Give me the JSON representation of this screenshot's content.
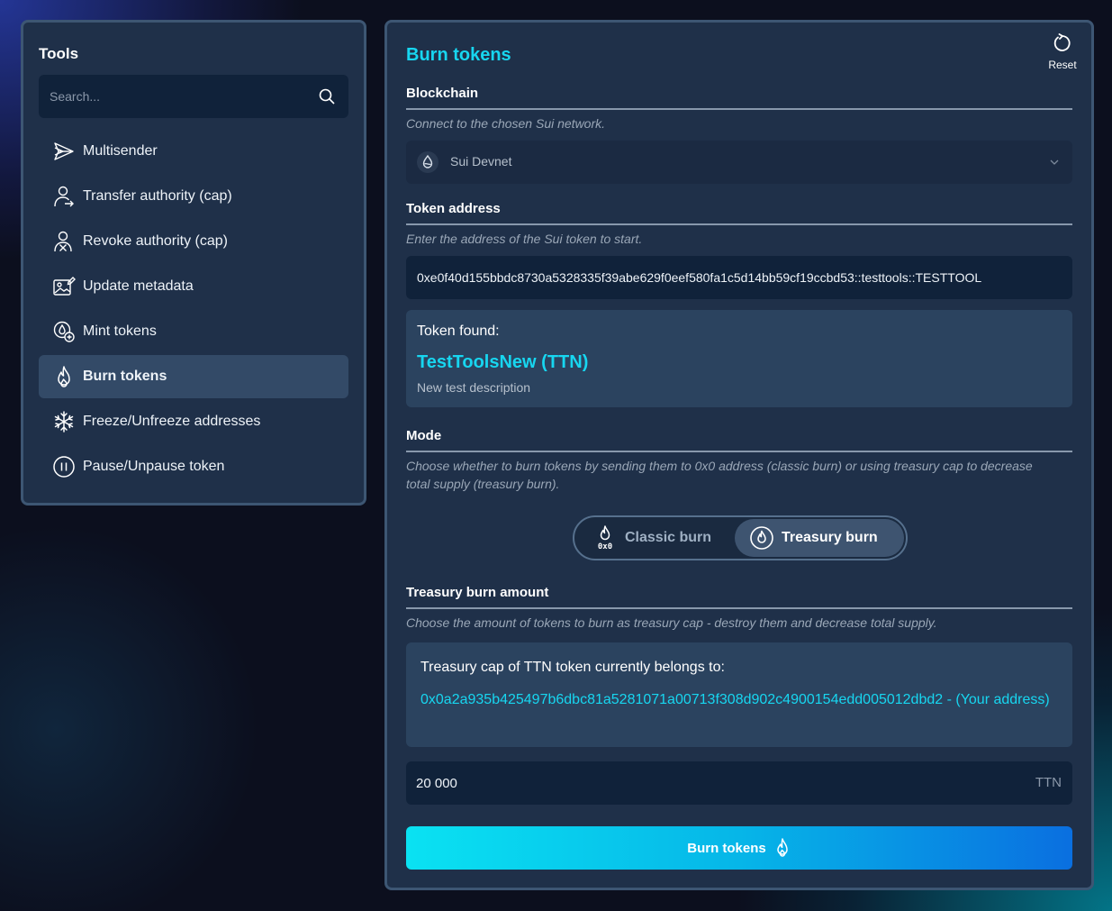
{
  "sidebar": {
    "title": "Tools",
    "search_placeholder": "Search...",
    "items": [
      {
        "label": "Multisender",
        "icon": "multisender-icon"
      },
      {
        "label": "Transfer authority (cap)",
        "icon": "transfer-authority-icon"
      },
      {
        "label": "Revoke authority (cap)",
        "icon": "revoke-authority-icon"
      },
      {
        "label": "Update metadata",
        "icon": "update-metadata-icon"
      },
      {
        "label": "Mint tokens",
        "icon": "mint-tokens-icon"
      },
      {
        "label": "Burn tokens",
        "icon": "flame-icon",
        "active": true
      },
      {
        "label": "Freeze/Unfreeze addresses",
        "icon": "snowflake-icon"
      },
      {
        "label": "Pause/Unpause token",
        "icon": "pause-icon"
      }
    ]
  },
  "main": {
    "title": "Burn tokens",
    "reset_label": "Reset",
    "blockchain": {
      "label": "Blockchain",
      "hint": "Connect to the chosen Sui network.",
      "selected": "Sui Devnet"
    },
    "token_address": {
      "label": "Token address",
      "hint": "Enter the address of the Sui token to start.",
      "value": "0xe0f40d155bbdc8730a5328335f39abe629f0eef580fa1c5d14bb59cf19ccbd53::testtools::TESTTOOL"
    },
    "token_found": {
      "label": "Token found:",
      "name": "TestToolsNew (TTN)",
      "description": "New test description"
    },
    "mode": {
      "label": "Mode",
      "hint": "Choose whether to burn tokens by sending them to 0x0 address (classic burn) or using treasury cap to decrease total supply (treasury burn).",
      "options": [
        {
          "label": "Classic burn",
          "icon": "classic-burn-icon",
          "selected": false
        },
        {
          "label": "Treasury burn",
          "icon": "treasury-burn-icon",
          "selected": true
        }
      ],
      "classic_icon_text": "0x0"
    },
    "treasury_amount": {
      "label": "Treasury burn amount",
      "hint": "Choose the amount of tokens to burn as treasury cap - destroy them and decrease total supply.",
      "cap_label": "Treasury cap of TTN token currently belongs to:",
      "cap_address": "0x0a2a935b425497b6dbc81a5281071a00713f308d902c4900154edd005012dbd2 - (Your address)",
      "amount": "20 000",
      "unit": "TTN"
    },
    "submit_label": "Burn tokens"
  },
  "colors": {
    "accent": "#17d6f0",
    "panel": "#1f3049",
    "panel_border": "#3d5673",
    "input_bg": "#10223a",
    "card_bg": "#2b435f"
  }
}
